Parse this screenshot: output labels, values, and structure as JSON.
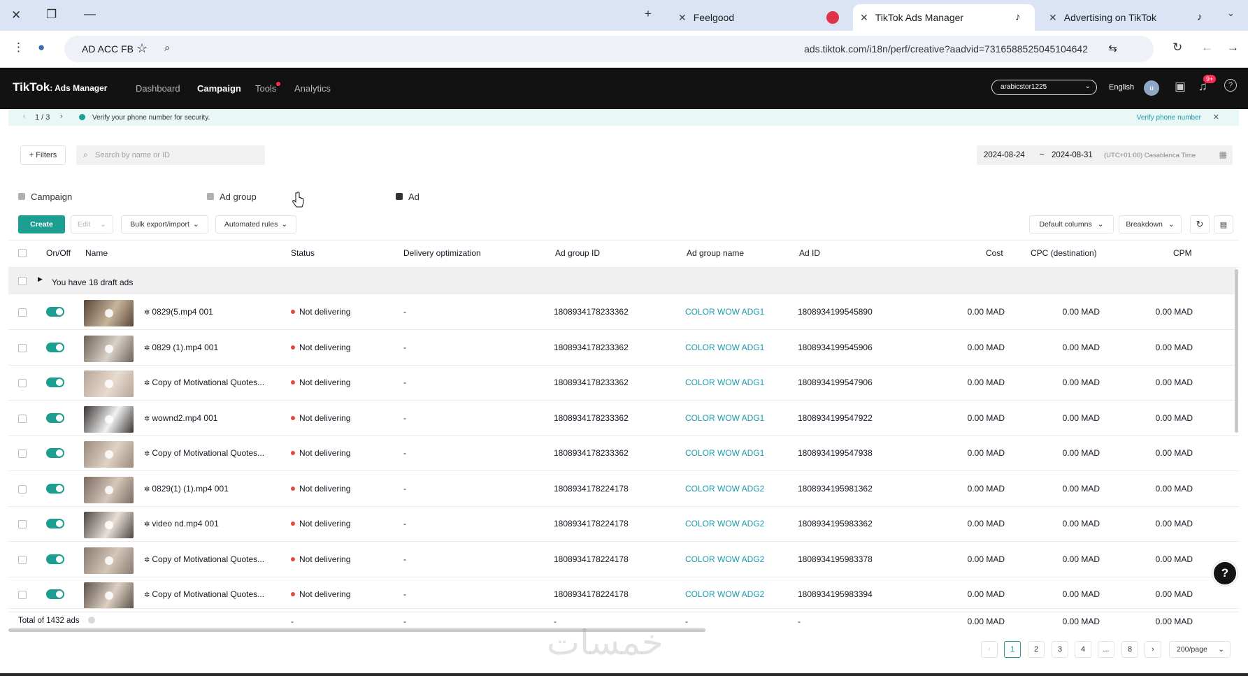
{
  "browser": {
    "tabs": [
      {
        "title": "Advertising on TikTok"
      },
      {
        "title": "TikTok Ads Manager"
      },
      {
        "title": "Feelgood"
      }
    ],
    "address_label": "AD ACC FB",
    "url": "ads.tiktok.com/i18n/perf/creative?aadvid=7316588525045104642"
  },
  "app": {
    "brand": "TikTok",
    "brand_sub": ": Ads Manager",
    "nav": [
      "Dashboard",
      "Campaign",
      "Tools",
      "Analytics"
    ],
    "account": "arabicstor1225",
    "language": "English",
    "avatar_letter": "u",
    "notification_badge": "9+"
  },
  "verify_bar": {
    "pager": "1 / 3",
    "message": "Verify your phone number for security.",
    "action": "Verify phone number"
  },
  "filters": {
    "filters_label": "+ Filters",
    "search_placeholder": "Search by name or ID",
    "date_start": "2024-08-24",
    "date_sep": "~",
    "date_end": "2024-08-31",
    "timezone": "(UTC+01:00) Casablanca Time"
  },
  "level_tabs": [
    "Campaign",
    "Ad group",
    "Ad"
  ],
  "toolbar": {
    "create": "Create",
    "edit": "Edit",
    "bulk": "Bulk export/import",
    "automated": "Automated rules",
    "default_columns": "Default columns",
    "breakdown": "Breakdown"
  },
  "columns": {
    "onoff": "On/Off",
    "name": "Name",
    "status": "Status",
    "delivery": "Delivery optimization",
    "adgroup_id": "Ad group ID",
    "adgroup_name": "Ad group name",
    "ad_id": "Ad ID",
    "cost": "Cost",
    "cpc": "CPC (destination)",
    "cpm": "CPM"
  },
  "draft_row": "You have 18 draft ads",
  "rows": [
    {
      "name": "0829(5.mp4 001",
      "status": "Not delivering",
      "delivery": "-",
      "adgroup_id": "1808934178233362",
      "adgroup_name": "COLOR WOW ADG1",
      "ad_id": "1808934199545890",
      "cost": "0.00 MAD",
      "cpc": "0.00 MAD",
      "cpm": "0.00 MAD"
    },
    {
      "name": "0829 (1).mp4 001",
      "status": "Not delivering",
      "delivery": "-",
      "adgroup_id": "1808934178233362",
      "adgroup_name": "COLOR WOW ADG1",
      "ad_id": "1808934199545906",
      "cost": "0.00 MAD",
      "cpc": "0.00 MAD",
      "cpm": "0.00 MAD"
    },
    {
      "name": "Copy of Motivational Quotes...",
      "status": "Not delivering",
      "delivery": "-",
      "adgroup_id": "1808934178233362",
      "adgroup_name": "COLOR WOW ADG1",
      "ad_id": "1808934199547906",
      "cost": "0.00 MAD",
      "cpc": "0.00 MAD",
      "cpm": "0.00 MAD"
    },
    {
      "name": "wownd2.mp4 001",
      "status": "Not delivering",
      "delivery": "-",
      "adgroup_id": "1808934178233362",
      "adgroup_name": "COLOR WOW ADG1",
      "ad_id": "1808934199547922",
      "cost": "0.00 MAD",
      "cpc": "0.00 MAD",
      "cpm": "0.00 MAD"
    },
    {
      "name": "Copy of Motivational Quotes...",
      "status": "Not delivering",
      "delivery": "-",
      "adgroup_id": "1808934178233362",
      "adgroup_name": "COLOR WOW ADG1",
      "ad_id": "1808934199547938",
      "cost": "0.00 MAD",
      "cpc": "0.00 MAD",
      "cpm": "0.00 MAD"
    },
    {
      "name": "0829(1) (1).mp4 001",
      "status": "Not delivering",
      "delivery": "-",
      "adgroup_id": "1808934178224178",
      "adgroup_name": "COLOR WOW ADG2",
      "ad_id": "1808934195981362",
      "cost": "0.00 MAD",
      "cpc": "0.00 MAD",
      "cpm": "0.00 MAD"
    },
    {
      "name": "video nd.mp4 001",
      "status": "Not delivering",
      "delivery": "-",
      "adgroup_id": "1808934178224178",
      "adgroup_name": "COLOR WOW ADG2",
      "ad_id": "1808934195983362",
      "cost": "0.00 MAD",
      "cpc": "0.00 MAD",
      "cpm": "0.00 MAD"
    },
    {
      "name": "Copy of Motivational Quotes...",
      "status": "Not delivering",
      "delivery": "-",
      "adgroup_id": "1808934178224178",
      "adgroup_name": "COLOR WOW ADG2",
      "ad_id": "1808934195983378",
      "cost": "0.00 MAD",
      "cpc": "0.00 MAD",
      "cpm": "0.00 MAD"
    },
    {
      "name": "Copy of Motivational Quotes...",
      "status": "Not delivering",
      "delivery": "-",
      "adgroup_id": "1808934178224178",
      "adgroup_name": "COLOR WOW ADG2",
      "ad_id": "1808934195983394",
      "cost": "0.00 MAD",
      "cpc": "0.00 MAD",
      "cpm": "0.00 MAD"
    }
  ],
  "total_row": {
    "label": "Total of 1432 ads",
    "status": "-",
    "delivery": "-",
    "adgroup_id": "-",
    "adgroup_name": "-",
    "ad_id": "-",
    "cost": "0.00 MAD",
    "cpc": "0.00 MAD",
    "cpm": "0.00 MAD"
  },
  "pagination": {
    "pages": [
      "1",
      "2",
      "3",
      "4",
      "...",
      "8"
    ],
    "current": "1",
    "per_page": "200/page"
  },
  "watermark": "خمسات",
  "colors": {
    "accent": "#1c9e90",
    "link": "#1a9bab",
    "status_red": "#e4473f",
    "header_bg": "#121212"
  }
}
